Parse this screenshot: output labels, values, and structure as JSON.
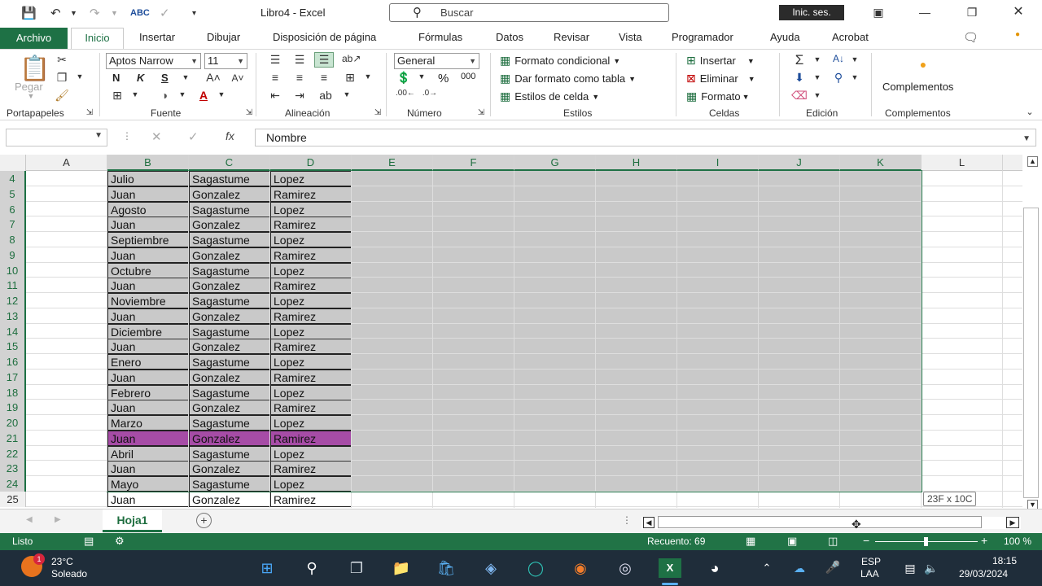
{
  "title_bar": {
    "doc_title": "Libro4  -  Excel",
    "search_placeholder": "Buscar",
    "signin_label": "Inic. ses."
  },
  "ribbon": {
    "tabs": [
      "Archivo",
      "Inicio",
      "Insertar",
      "Dibujar",
      "Disposición de página",
      "Fórmulas",
      "Datos",
      "Revisar",
      "Vista",
      "Programador",
      "Ayuda",
      "Acrobat"
    ],
    "active_tab": "Inicio",
    "clipboard": {
      "paste_label": "Pegar",
      "group_label": "Portapapeles"
    },
    "font": {
      "name": "Aptos Narrow",
      "size": "11",
      "bold": "N",
      "italic": "K",
      "underline": "S",
      "group_label": "Fuente"
    },
    "alignment": {
      "group_label": "Alineación"
    },
    "number": {
      "format": "General",
      "percent": "%",
      "thousands": "000",
      "group_label": "Número"
    },
    "styles": {
      "conditional": "Formato condicional",
      "as_table": "Dar formato como tabla",
      "cell_styles": "Estilos de celda",
      "group_label": "Estilos"
    },
    "cells": {
      "insert": "Insertar",
      "delete": "Eliminar",
      "format": "Formato",
      "group_label": "Celdas"
    },
    "editing": {
      "group_label": "Edición"
    },
    "addins": {
      "button_label": "Complementos",
      "group_label": "Complementos"
    }
  },
  "formula_bar": {
    "name_box": "",
    "fx_label": "fx",
    "formula": "Nombre"
  },
  "columns": [
    "A",
    "B",
    "C",
    "D",
    "E",
    "F",
    "G",
    "H",
    "I",
    "J",
    "K",
    "L"
  ],
  "rows": [
    {
      "n": "4",
      "b": "Julio",
      "c": "Sagastume",
      "d": "Lopez"
    },
    {
      "n": "5",
      "b": "Juan",
      "c": "Gonzalez",
      "d": "Ramirez"
    },
    {
      "n": "6",
      "b": "Agosto",
      "c": "Sagastume",
      "d": "Lopez"
    },
    {
      "n": "7",
      "b": "Juan",
      "c": "Gonzalez",
      "d": "Ramirez"
    },
    {
      "n": "8",
      "b": "Septiembre",
      "c": "Sagastume",
      "d": "Lopez"
    },
    {
      "n": "9",
      "b": "Juan",
      "c": "Gonzalez",
      "d": "Ramirez"
    },
    {
      "n": "10",
      "b": "Octubre",
      "c": "Sagastume",
      "d": "Lopez"
    },
    {
      "n": "11",
      "b": "Juan",
      "c": "Gonzalez",
      "d": "Ramirez"
    },
    {
      "n": "12",
      "b": "Noviembre",
      "c": "Sagastume",
      "d": "Lopez"
    },
    {
      "n": "13",
      "b": "Juan",
      "c": "Gonzalez",
      "d": "Ramirez"
    },
    {
      "n": "14",
      "b": "Diciembre",
      "c": "Sagastume",
      "d": "Lopez"
    },
    {
      "n": "15",
      "b": "Juan",
      "c": "Gonzalez",
      "d": "Ramirez"
    },
    {
      "n": "16",
      "b": "Enero",
      "c": "Sagastume",
      "d": "Lopez"
    },
    {
      "n": "17",
      "b": "Juan",
      "c": "Gonzalez",
      "d": "Ramirez"
    },
    {
      "n": "18",
      "b": "Febrero",
      "c": "Sagastume",
      "d": "Lopez"
    },
    {
      "n": "19",
      "b": "Juan",
      "c": "Gonzalez",
      "d": "Ramirez"
    },
    {
      "n": "20",
      "b": "Marzo",
      "c": "Sagastume",
      "d": "Lopez"
    },
    {
      "n": "21",
      "b": "Juan",
      "c": "Gonzalez",
      "d": "Ramirez",
      "highlight": true
    },
    {
      "n": "22",
      "b": "Abril",
      "c": "Sagastume",
      "d": "Lopez"
    },
    {
      "n": "23",
      "b": "Juan",
      "c": "Gonzalez",
      "d": "Ramirez"
    },
    {
      "n": "24",
      "b": "Mayo",
      "c": "Sagastume",
      "d": "Lopez"
    },
    {
      "n": "25",
      "b": "Juan",
      "c": "Gonzalez",
      "d": "Ramirez"
    }
  ],
  "highlight_color": "#a64ca6",
  "selection_tip": "23F x 10C",
  "sheet_tab": "Hoja1",
  "status_bar": {
    "ready": "Listo",
    "count": "Recuento: 69",
    "zoom": "100 %"
  },
  "taskbar": {
    "weather_temp": "23°C",
    "weather_desc": "Soleado",
    "weather_badge": "1",
    "lang_top": "ESP",
    "lang_bottom": "LAA",
    "time": "18:15",
    "date": "29/03/2024"
  },
  "accent_color": "#217346"
}
